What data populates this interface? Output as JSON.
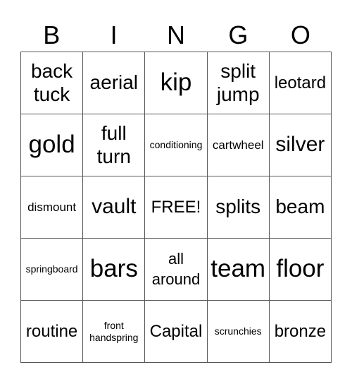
{
  "header": [
    "B",
    "I",
    "N",
    "G",
    "O"
  ],
  "cells": [
    [
      "back tuck",
      "aerial",
      "kip",
      "split jump",
      "leotard"
    ],
    [
      "gold",
      "full turn",
      "conditioning",
      "cartwheel",
      "silver"
    ],
    [
      "dismount",
      "vault",
      "FREE!",
      "splits",
      "beam"
    ],
    [
      "springboard",
      "bars",
      "all around",
      "team",
      "floor"
    ],
    [
      "routine",
      "front handspring",
      "Capital",
      "scrunchies",
      "bronze"
    ]
  ]
}
